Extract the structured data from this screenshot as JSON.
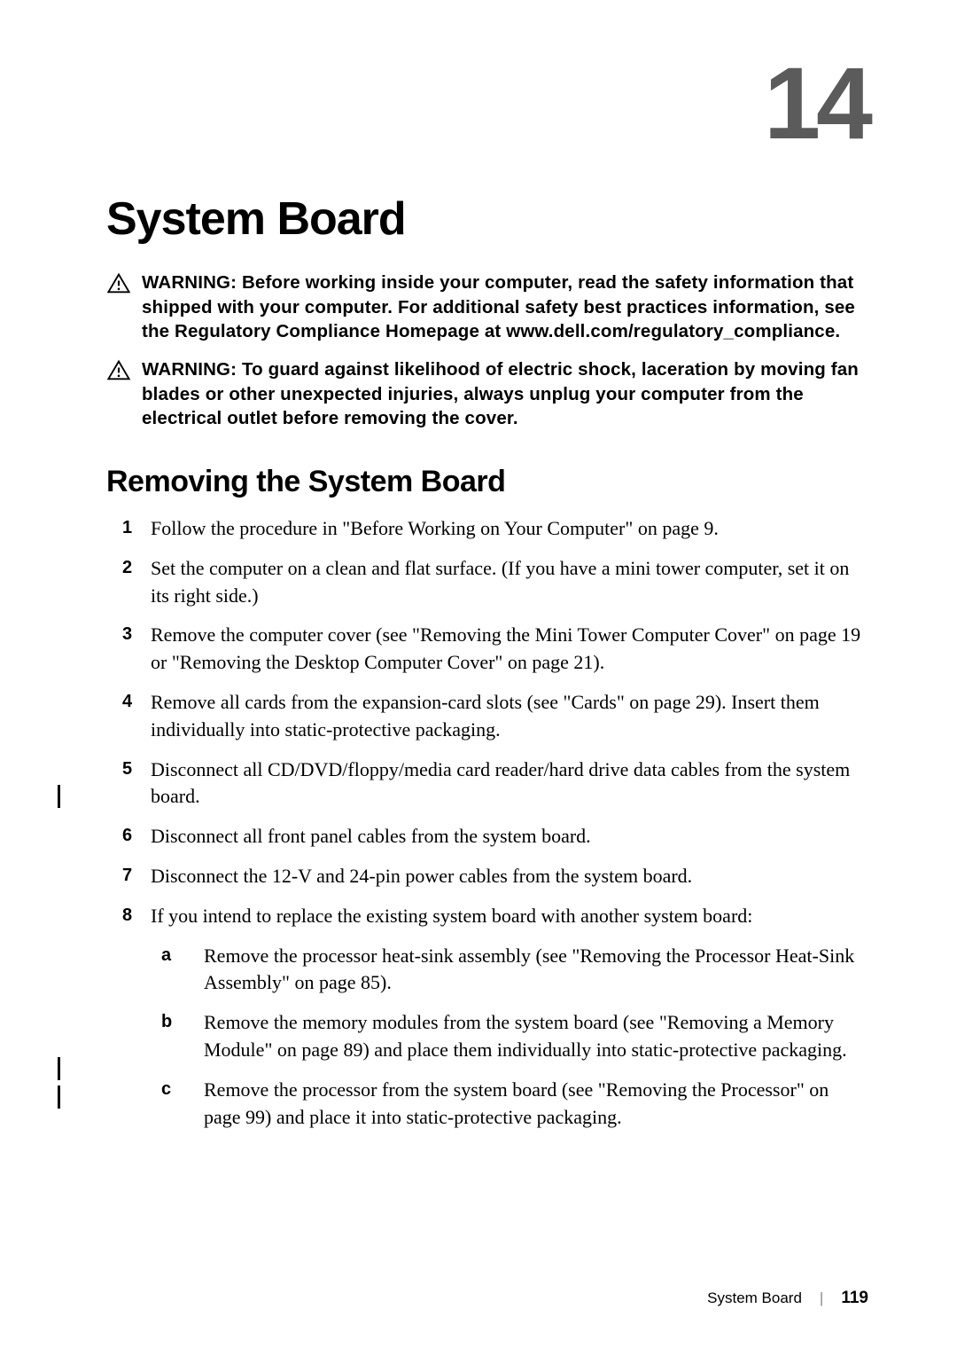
{
  "chapter_number": "14",
  "chapter_title": "System Board",
  "warnings": [
    {
      "label": "WARNING: ",
      "text": "Before working inside your computer, read the safety information that shipped with your computer. For additional safety best practices information, see the Regulatory Compliance Homepage at www.dell.com/regulatory_compliance."
    },
    {
      "label": "WARNING: ",
      "text": "To guard against likelihood of electric shock, laceration by moving fan blades or other unexpected injuries, always unplug your computer from the electrical outlet before removing the cover."
    }
  ],
  "section_title": "Removing the System Board",
  "steps": [
    "Follow the procedure in \"Before Working on Your Computer\" on page 9.",
    "Set the computer on a clean and flat surface. (If you have a mini tower computer, set it on its right side.)",
    "Remove the computer cover (see \"Removing the Mini Tower Computer Cover\" on page 19 or \"Removing the Desktop Computer Cover\" on page 21).",
    "Remove all cards from the expansion-card slots (see \"Cards\" on page 29). Insert them individually into static-protective packaging.",
    "Disconnect all CD/DVD/floppy/media card reader/hard drive data cables from the system board.",
    "Disconnect all front panel cables from the system board.",
    "Disconnect the 12-V and 24-pin power cables from the system board.",
    "If you intend to replace the existing system board with another system board:"
  ],
  "sub_steps": [
    {
      "marker": "a",
      "text": "Remove the processor heat-sink assembly (see \"Removing the Processor Heat-Sink Assembly\" on page 85)."
    },
    {
      "marker": "b",
      "text": "Remove the memory modules from the system board (see \"Removing a Memory Module\" on page 89) and place them individually into static-protective packaging."
    },
    {
      "marker": "c",
      "text": "Remove the processor from the system board (see \"Removing the Processor\" on page 99) and place it into static-protective packaging."
    }
  ],
  "footer": {
    "section": "System Board",
    "page": "119"
  }
}
